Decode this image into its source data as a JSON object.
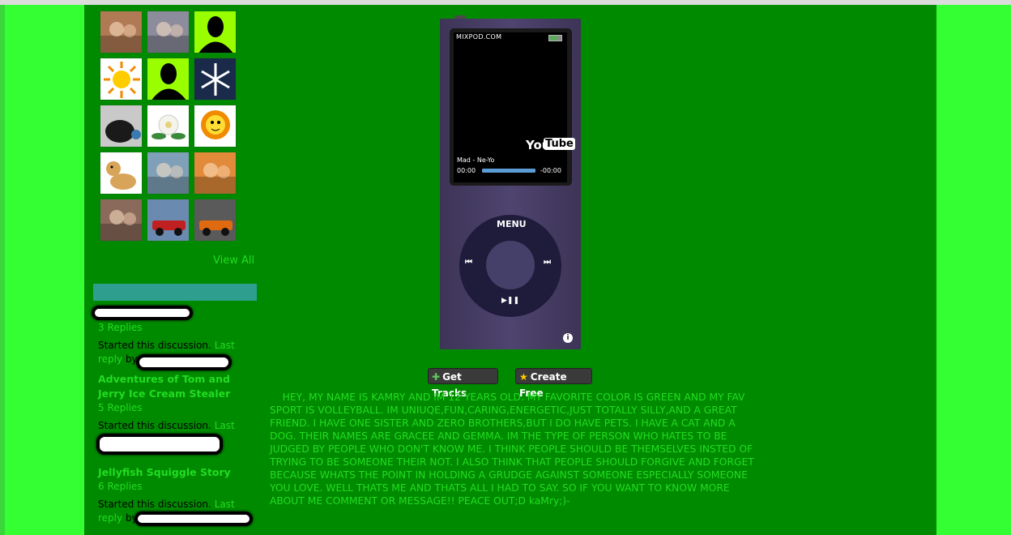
{
  "friends": {
    "thumbnails": [
      {
        "icon": "photo-icon",
        "bg": "#b07a55"
      },
      {
        "icon": "photo-icon",
        "bg": "#8c8c9c"
      },
      {
        "icon": "silhouette-icon",
        "bg": "#99ff00"
      },
      {
        "icon": "sun-icon",
        "bg": "#ffffff"
      },
      {
        "icon": "silhouette-icon",
        "bg": "#99ff00"
      },
      {
        "icon": "snowflake-icon",
        "bg": "#1a2a4a"
      },
      {
        "icon": "dog-photo-icon",
        "bg": "#c9c9c9"
      },
      {
        "icon": "flower-icon",
        "bg": "#ffffff"
      },
      {
        "icon": "lion-drawing-icon",
        "bg": "#ffffff"
      },
      {
        "icon": "cartoon-dog-icon",
        "bg": "#ffffff"
      },
      {
        "icon": "photo-icon",
        "bg": "#7fa0b8"
      },
      {
        "icon": "photo-icon",
        "bg": "#e08a3a"
      },
      {
        "icon": "photo-icon",
        "bg": "#8a6a5a"
      },
      {
        "icon": "car-photo-icon",
        "bg": "#6a8ab0"
      },
      {
        "icon": "car-photo-icon",
        "bg": "#5a5a5a"
      }
    ],
    "view_all": "View All"
  },
  "discussions": {
    "header_color": "#2e9f8f",
    "items": [
      {
        "title": "",
        "replies": "3 Replies",
        "started": "Started this discussion.",
        "last": "Last",
        "reply": "reply",
        "by": "by"
      },
      {
        "title": "Adventures of Tom and Jerry Ice Cream Stealer",
        "replies": "5 Replies",
        "started": "Started this discussion.",
        "last": "Last",
        "reply": "",
        "by": ""
      },
      {
        "title": "Jellyfish Squiggle Story",
        "replies": "6 Replies",
        "started": "Started this discussion.",
        "last": "Last",
        "reply": "reply",
        "by": "by"
      }
    ]
  },
  "player": {
    "site": "MIXPOD.COM",
    "logo_you": "You",
    "logo_tube": "Tube",
    "track": "Mad - Ne-Yo",
    "time_start": "00:00",
    "time_end": "-00:00",
    "progress_fraction": 1.0,
    "menu": "MENU",
    "prev": "⏮",
    "next": "⏭",
    "playpause": "▶❚❚",
    "info": "i",
    "get_tracks": "Get Tracks",
    "create_free": "Create Free"
  },
  "bio": {
    "text": "HEY, MY NAME IS KAMRY AND IM 12 YEARS OLD. MY FAVORITE COLOR IS GREEN AND MY FAV SPORT IS VOLLEYBALL. IM UNIUQE,FUN,CARING,ENERGETIC,JUST TOTALLY SILLY,AND A GREAT FRIEND. I HAVE ONE SISTER AND ZERO BROTHERS,BUT I DO HAVE PETS. I HAVE A CAT AND A DOG. THEIR NAMES ARE GRACEE AND GEMMA. IM THE TYPE OF PERSON WHO HATES TO BE JUDGED BY PEOPLE WHO DON'T KNOW ME. I THINK PEOPLE SHOULD BE THEMSELVES INSTED OF TRYING TO BE SOMEONE THEIR NOT. I ALSO THINK THAT PEOPLE SHOULD FORGIVE AND FORGET BECAUSE WHATS THE POINT IN HOLDING A GRUDGE AGAINST SOMEONE ESPECIALLY SOMEONE YOU LOVE. WELL THATS ME AND THATS ALL I HAD TO SAY. SO IF YOU WANT TO KNOW MORE ABOUT ME COMMENT OR MESSAGE!! PEACE OUT;D kaMry;)-"
  },
  "colors": {
    "outer_bg": "#33ff33",
    "page_bg": "#008a00",
    "link": "#22dd22"
  }
}
